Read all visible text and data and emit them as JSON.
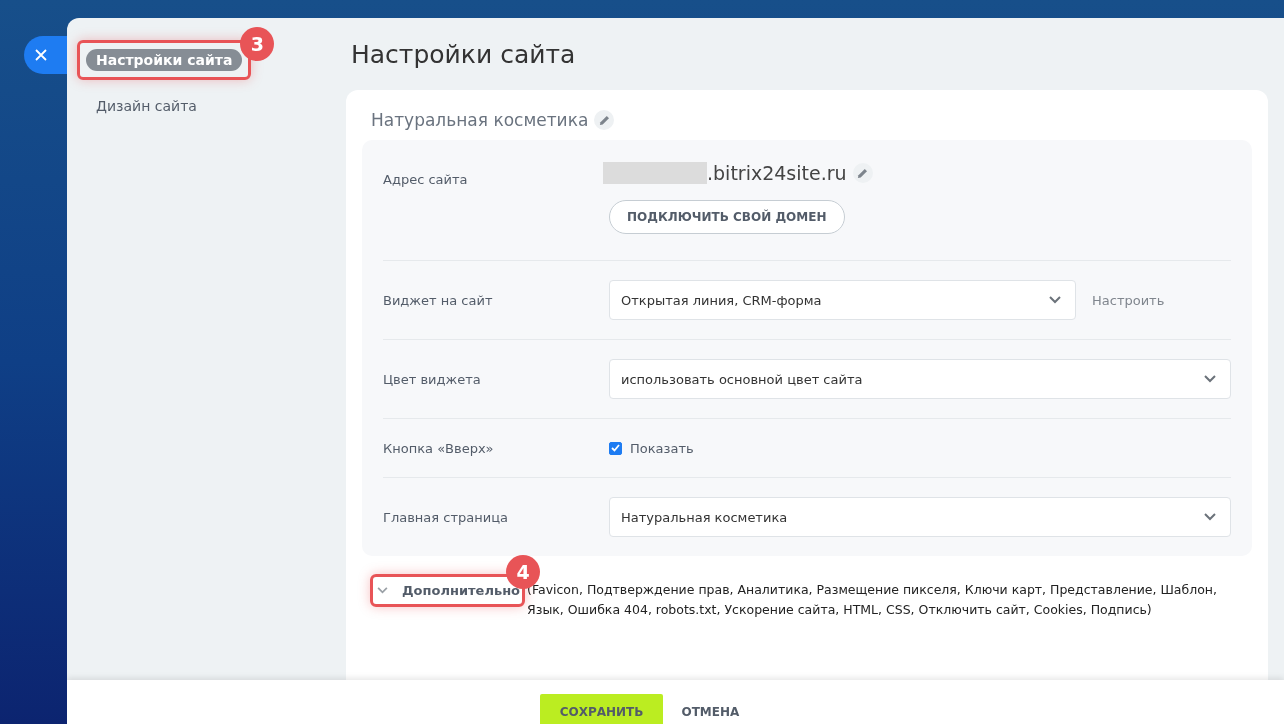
{
  "nav": {
    "items": [
      {
        "label": "Настройки сайта",
        "selected": true,
        "callout": "3"
      },
      {
        "label": "Дизайн сайта",
        "selected": false
      }
    ]
  },
  "page": {
    "title": "Настройки сайта",
    "site_name": "Натуральная косметика"
  },
  "settings": {
    "rows": [
      {
        "kind": "address",
        "label": "Адрес сайта",
        "domain_suffix": ".bitrix24site.ru",
        "button": "ПОДКЛЮЧИТЬ СВОЙ ДОМЕН"
      },
      {
        "kind": "select",
        "label": "Виджет на сайт",
        "value": "Открытая линия, CRM-форма",
        "link": "Настроить"
      },
      {
        "kind": "select",
        "label": "Цвет виджета",
        "value": "использовать основной цвет сайта"
      },
      {
        "kind": "checkbox",
        "label": "Кнопка «Вверх»",
        "option": "Показать",
        "checked": true
      },
      {
        "kind": "select",
        "label": "Главная страница",
        "value": "Натуральная косметика"
      }
    ]
  },
  "advanced": {
    "label": "Дополнительно",
    "expanded": false,
    "callout": "4",
    "summary": "(Favicon,  Подтверждение прав,  Аналитика,  Размещение пикселя,  Ключи карт,  Представление,  Шаблон,  Язык,  Ошибка 404,  robots.txt,  Ускорение сайта,  HTML,  CSS,  Отключить сайт,  Cookies,  Подпись)"
  },
  "footer": {
    "buttons": [
      {
        "label": "СОХРАНИТЬ",
        "kind": "primary"
      },
      {
        "label": "ОТМЕНА",
        "kind": "link"
      }
    ]
  }
}
